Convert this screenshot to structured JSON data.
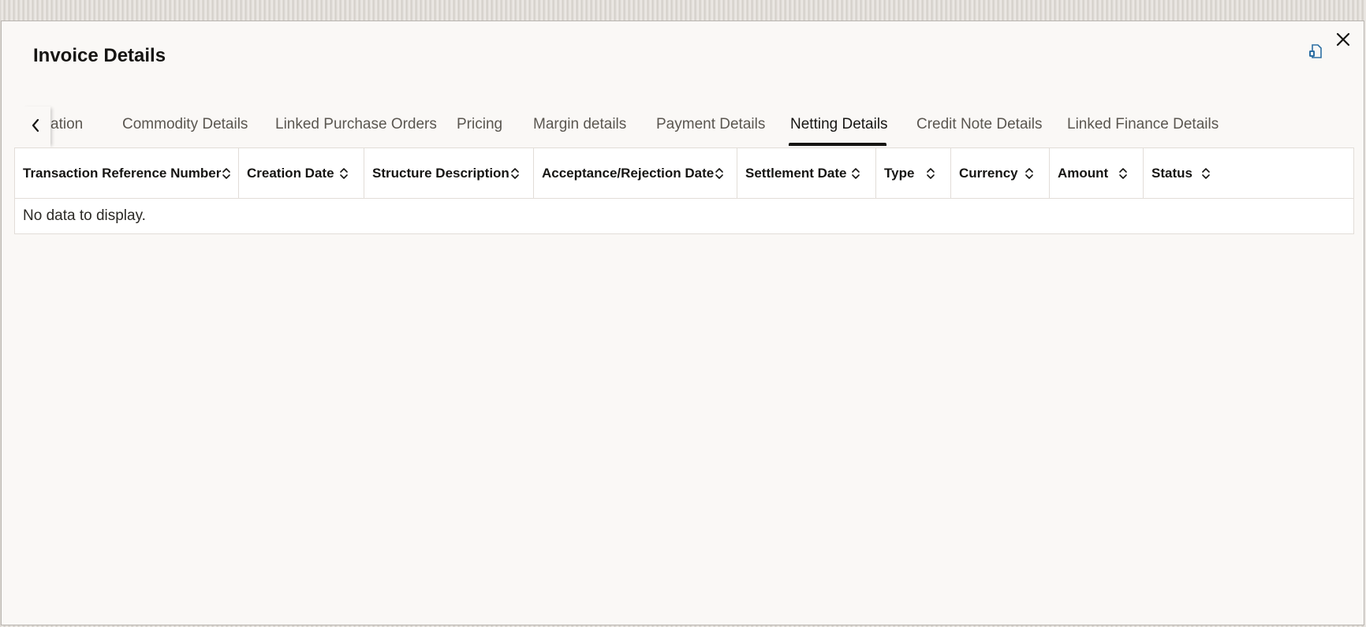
{
  "dialog": {
    "title": "Invoice Details"
  },
  "icons": {
    "export": "export-document-icon",
    "close": "close-icon",
    "prev": "chevron-left-icon",
    "sort": "sort-icon"
  },
  "tabs": [
    {
      "label": "ation",
      "active": false
    },
    {
      "label": "Commodity Details",
      "active": false
    },
    {
      "label": "Linked Purchase Orders",
      "active": false
    },
    {
      "label": "Pricing",
      "active": false
    },
    {
      "label": "Margin details",
      "active": false
    },
    {
      "label": "Payment Details",
      "active": false
    },
    {
      "label": "Netting Details",
      "active": true
    },
    {
      "label": "Credit Note Details",
      "active": false
    },
    {
      "label": "Linked Finance Details",
      "active": false
    }
  ],
  "table": {
    "columns": [
      "Transaction Reference Number",
      "Creation Date",
      "Structure Description",
      "Acceptance/Rejection Date",
      "Settlement Date",
      "Type",
      "Currency",
      "Amount",
      "Status"
    ],
    "empty_message": "No data to display."
  },
  "colors": {
    "dialog_bg": "#faf8f6",
    "text_primary": "#161513",
    "text_secondary": "#5a5650",
    "accent_icon": "#2d6fa3"
  }
}
